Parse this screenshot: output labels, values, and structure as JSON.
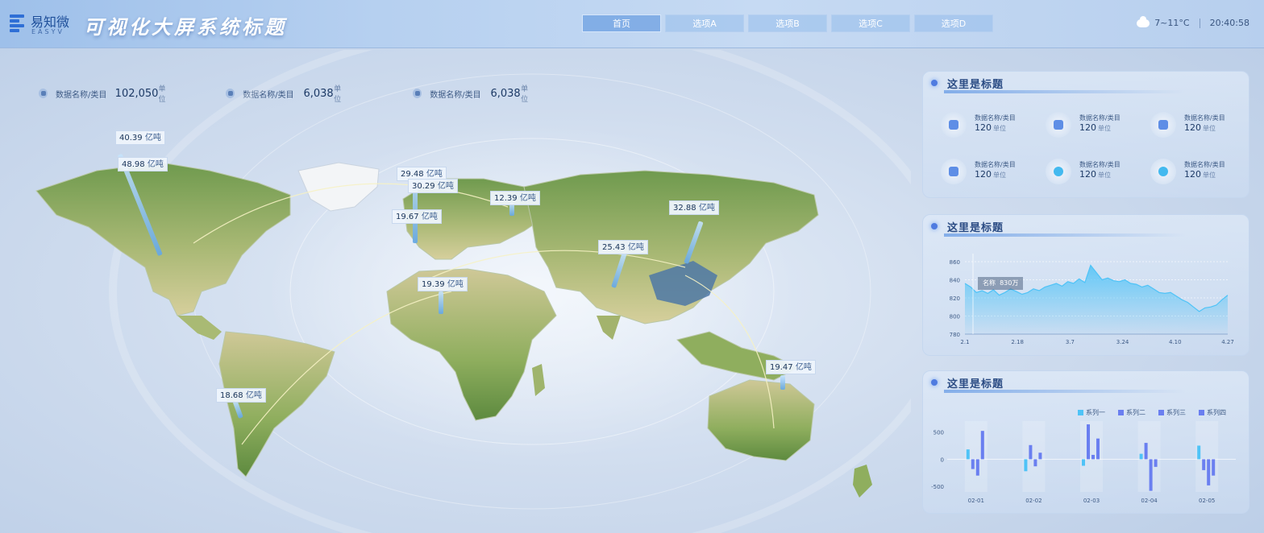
{
  "header": {
    "logo_cn": "易知微",
    "logo_en": "EASYV",
    "title": "可视化大屏系统标题",
    "nav": [
      {
        "label": "首页",
        "active": true
      },
      {
        "label": "选项A",
        "active": false
      },
      {
        "label": "选项B",
        "active": false
      },
      {
        "label": "选项C",
        "active": false
      },
      {
        "label": "选项D",
        "active": false
      }
    ],
    "weather": {
      "temp": "7~11°C",
      "time": "20:40:58",
      "icon": "cloud-icon"
    }
  },
  "stats": [
    {
      "label": "数据名称/类目",
      "value": "102,050",
      "unit": "单位",
      "icon": "shield-icon"
    },
    {
      "label": "数据名称/类目",
      "value": "6,038",
      "unit": "单位",
      "icon": "user-icon"
    },
    {
      "label": "数据名称/类目",
      "value": "6,038",
      "unit": "单位",
      "icon": "user-icon"
    }
  ],
  "map": {
    "callouts": [
      {
        "value": "40.39",
        "unit": "亿吨"
      },
      {
        "value": "48.98",
        "unit": "亿吨"
      },
      {
        "value": "29.48",
        "unit": "亿吨"
      },
      {
        "value": "30.29",
        "unit": "亿吨"
      },
      {
        "value": "12.39",
        "unit": "亿吨"
      },
      {
        "value": "19.67",
        "unit": "亿吨"
      },
      {
        "value": "32.88",
        "unit": "亿吨"
      },
      {
        "value": "25.43",
        "unit": "亿吨"
      },
      {
        "value": "19.39",
        "unit": "亿吨"
      },
      {
        "value": "19.47",
        "unit": "亿吨"
      },
      {
        "value": "18.68",
        "unit": "亿吨"
      }
    ]
  },
  "panel1": {
    "title": "这里是标题",
    "kpis": [
      {
        "label": "数据名称/类目",
        "value": "120",
        "unit": "单位",
        "icon": "user-card-icon"
      },
      {
        "label": "数据名称/类目",
        "value": "120",
        "unit": "单位",
        "icon": "calendar-icon"
      },
      {
        "label": "数据名称/类目",
        "value": "120",
        "unit": "单位",
        "icon": "document-icon"
      },
      {
        "label": "数据名称/类目",
        "value": "120",
        "unit": "单位",
        "icon": "image-icon"
      },
      {
        "label": "数据名称/类目",
        "value": "120",
        "unit": "单位",
        "icon": "circle-icon"
      },
      {
        "label": "数据名称/类目",
        "value": "120",
        "unit": "单位",
        "icon": "pie-icon"
      }
    ]
  },
  "panel2": {
    "title": "这里是标题",
    "tooltip": {
      "name": "名称",
      "value": "830万"
    },
    "chart_data": {
      "type": "area",
      "x_ticks": [
        "2.1",
        "2.18",
        "3.7",
        "3.24",
        "4.10",
        "4.27"
      ],
      "y_ticks": [
        780,
        800,
        820,
        840,
        860
      ],
      "ylim": [
        780,
        860
      ],
      "values": [
        836,
        832,
        826,
        828,
        825,
        829,
        823,
        826,
        830,
        827,
        824,
        826,
        830,
        828,
        832,
        834,
        836,
        833,
        838,
        836,
        841,
        837,
        856,
        848,
        840,
        842,
        839,
        838,
        840,
        836,
        835,
        832,
        834,
        830,
        826,
        825,
        826,
        822,
        818,
        815,
        810,
        805,
        809,
        810,
        812,
        818,
        823
      ]
    }
  },
  "panel3": {
    "title": "这里是标题",
    "chart_data": {
      "type": "bar",
      "categories": [
        "02-01",
        "02-02",
        "02-03",
        "02-04",
        "02-05"
      ],
      "y_ticks": [
        500,
        0,
        -500
      ],
      "ylim": [
        -600,
        700
      ],
      "series": [
        {
          "name": "系列一",
          "color": "#4fc3f7",
          "values": [
            180,
            -220,
            -120,
            100,
            250
          ]
        },
        {
          "name": "系列二",
          "color": "#6a7ff0",
          "values": [
            -180,
            260,
            640,
            300,
            -200
          ]
        },
        {
          "name": "系列三",
          "color": "#6a7ff0",
          "values": [
            -300,
            -130,
            80,
            -580,
            -480
          ]
        },
        {
          "name": "系列四",
          "color": "#6a7ff0",
          "values": [
            520,
            120,
            380,
            -140,
            -300
          ]
        }
      ]
    }
  }
}
